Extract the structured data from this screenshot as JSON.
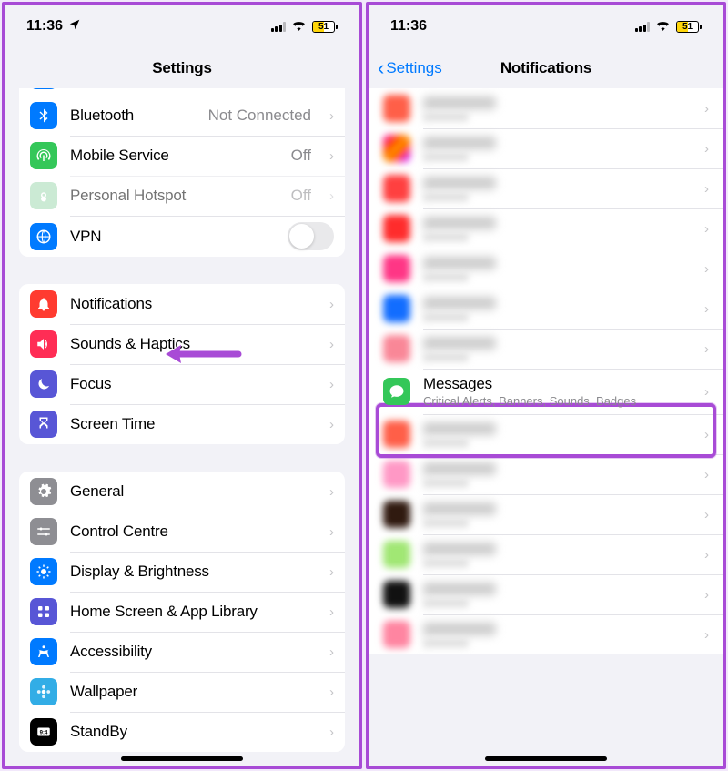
{
  "status": {
    "time": "11:36",
    "battery": "51"
  },
  "left": {
    "title": "Settings",
    "group1": [
      {
        "label": "Bluetooth",
        "value": "Not Connected"
      },
      {
        "label": "Mobile Service",
        "value": "Off"
      },
      {
        "label": "Personal Hotspot",
        "value": "Off"
      },
      {
        "label": "VPN"
      }
    ],
    "group2": [
      {
        "label": "Notifications"
      },
      {
        "label": "Sounds & Haptics"
      },
      {
        "label": "Focus"
      },
      {
        "label": "Screen Time"
      }
    ],
    "group3": [
      {
        "label": "General"
      },
      {
        "label": "Control Centre"
      },
      {
        "label": "Display & Brightness"
      },
      {
        "label": "Home Screen & App Library"
      },
      {
        "label": "Accessibility"
      },
      {
        "label": "Wallpaper"
      },
      {
        "label": "StandBy"
      }
    ]
  },
  "right": {
    "back": "Settings",
    "title": "Notifications",
    "messages": {
      "label": "Messages",
      "sub": "Critical Alerts, Banners, Sounds, Badges"
    }
  }
}
